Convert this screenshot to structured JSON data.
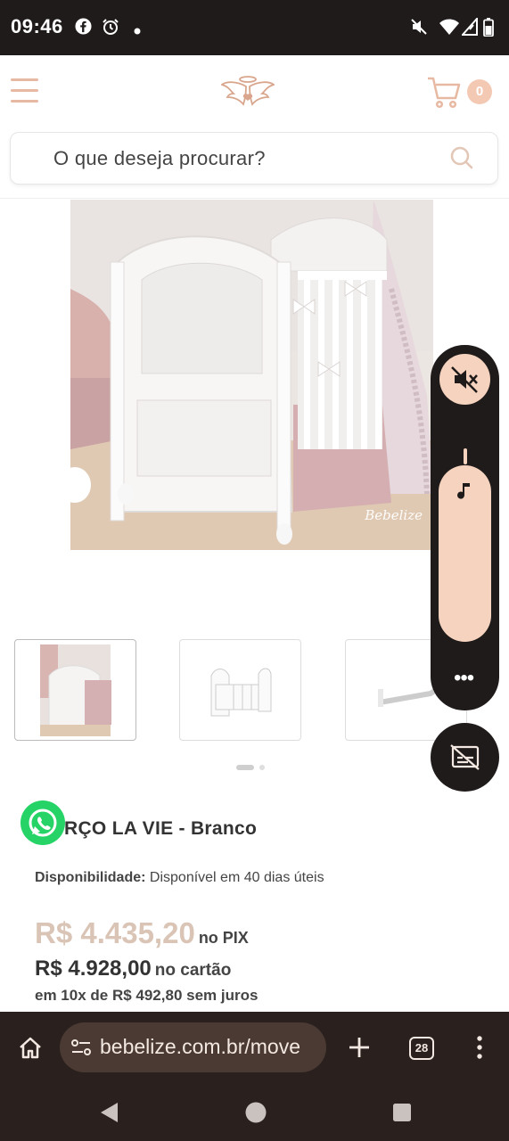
{
  "status_bar": {
    "time": "09:46",
    "left_icons": [
      "facebook-icon",
      "alarm-icon",
      "dot-icon"
    ],
    "right_icons": [
      "mute-icon",
      "wifi-icon",
      "signal-icon",
      "battery-icon"
    ]
  },
  "header": {
    "menu_icon": "hamburger-icon",
    "logo_icon": "angel-wings-logo",
    "cart_icon": "cart-icon",
    "cart_count": "0"
  },
  "search": {
    "placeholder": "O que deseja procurar?",
    "icon": "search-icon"
  },
  "product": {
    "image_watermark": "Bebelize",
    "thumbnails": [
      "thumbnail-1",
      "thumbnail-2",
      "thumbnail-3"
    ],
    "title": "RÇO LA VIE - Branco",
    "availability_label": "Disponibilidade:",
    "availability_value": "Disponível em 40 dias úteis",
    "price_pix": "R$ 4.435,20",
    "price_pix_suffix": "no PIX",
    "price_card": "R$ 4.928,00",
    "price_card_suffix": "no cartão",
    "installments": "em 10x de R$ 492,80 sem juros"
  },
  "overlay": {
    "whatsapp_icon": "whatsapp-icon",
    "volume_mute_icon": "volume-mute-icon",
    "music_note_icon": "music-note-icon",
    "more_label": "•••",
    "captions_icon": "captions-off-icon"
  },
  "browser": {
    "url": "bebelize.com.br/move",
    "tab_count": "28",
    "icons": [
      "home-icon",
      "site-info-icon",
      "new-tab-icon",
      "tabs-icon",
      "more-vert-icon"
    ]
  },
  "nav": {
    "icons": [
      "back-icon",
      "home-circle-icon",
      "recents-icon"
    ]
  },
  "colors": {
    "accent": "#f3c9b3",
    "price_pix": "#d9c4b5",
    "dark_bar": "#1f1b1a",
    "whatsapp": "#25d366"
  }
}
